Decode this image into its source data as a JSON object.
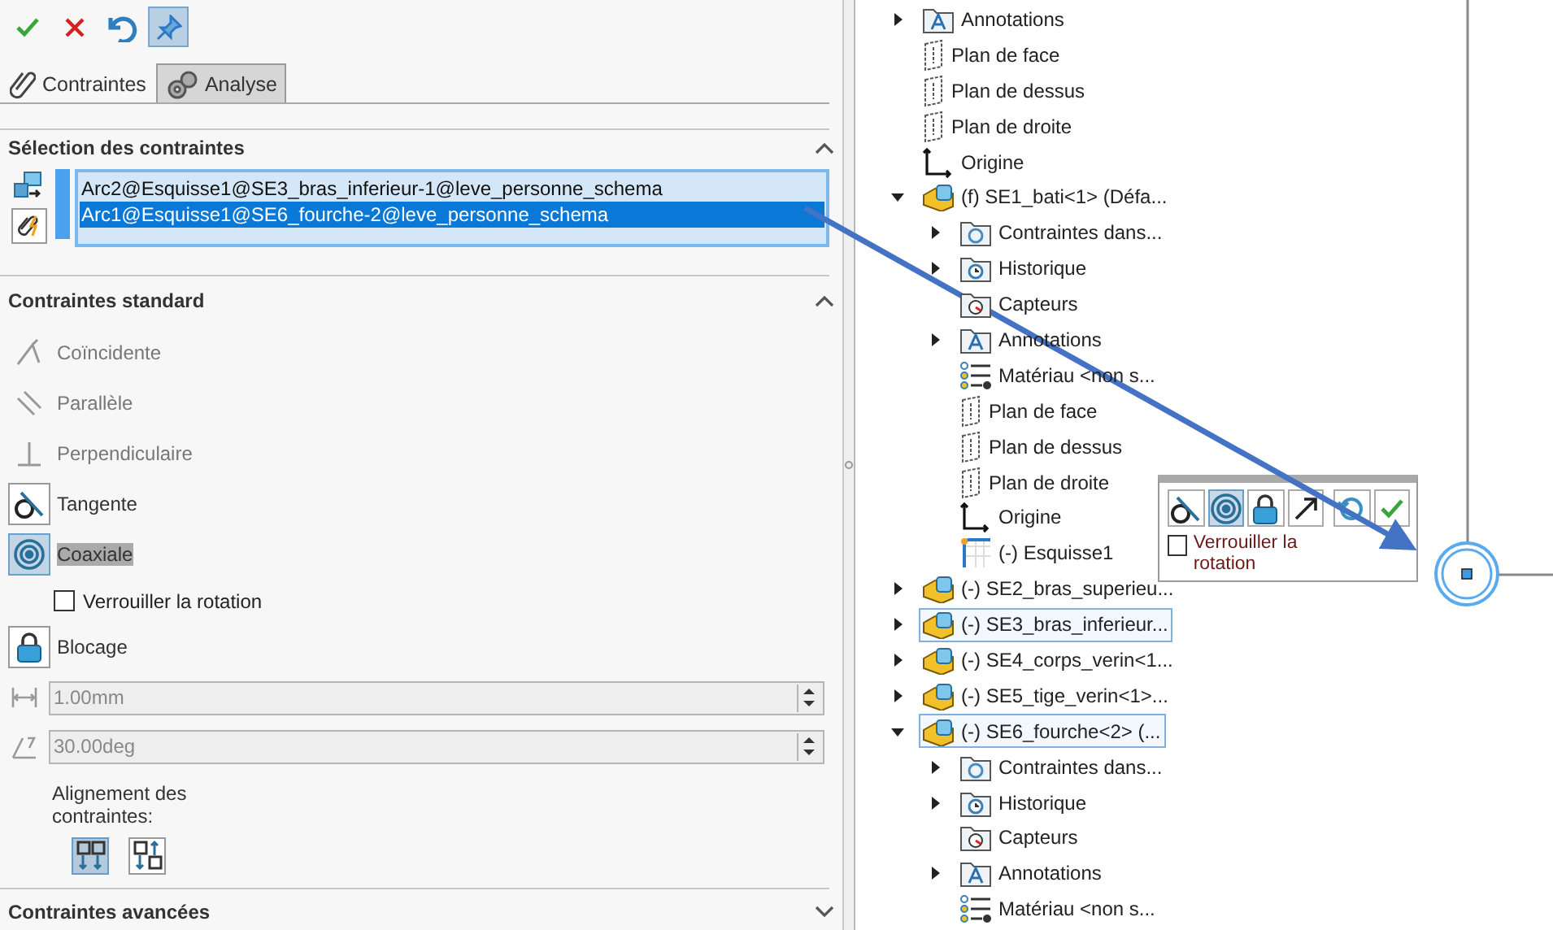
{
  "toolbar": [
    {
      "kind": "ok",
      "pressed": false
    },
    {
      "kind": "cancel",
      "pressed": false
    },
    {
      "kind": "undo",
      "pressed": false
    },
    {
      "kind": "pin",
      "pressed": true
    }
  ],
  "tabs": [
    {
      "label": "Contraintes",
      "kind": "paperclip",
      "selected": true
    },
    {
      "label": "Analyse",
      "kind": "gears",
      "selected": false
    }
  ],
  "selection_section": {
    "title": "Sélection des contraintes",
    "expanded": true,
    "entities": [
      {
        "text": "Arc2@Esquisse1@SE3_bras_inferieur-1@leve_personne_schema",
        "selected": false
      },
      {
        "text": "Arc1@Esquisse1@SE6_fourche-2@leve_personne_schema",
        "selected": true
      }
    ]
  },
  "standard_section": {
    "title": "Contraintes standard",
    "expanded": true,
    "rows": [
      {
        "kind": "coincident",
        "label": "Coïncidente",
        "disabled": true,
        "selected": false
      },
      {
        "kind": "parallel",
        "label": "Parallèle",
        "disabled": true,
        "selected": false
      },
      {
        "kind": "perpendicular",
        "label": "Perpendiculaire",
        "disabled": true,
        "selected": false
      },
      {
        "kind": "tangent",
        "label": "Tangente",
        "disabled": false,
        "selected": false
      },
      {
        "kind": "concentric",
        "label": "Coaxiale",
        "disabled": false,
        "selected": true
      },
      {
        "kind": "checkbox",
        "label": "Verrouiller la rotation",
        "checked": false
      },
      {
        "kind": "lock",
        "label": "Blocage",
        "disabled": false,
        "selected": false
      }
    ],
    "fields": [
      {
        "kind": "distance",
        "value": "1.00mm",
        "disabled": true
      },
      {
        "kind": "angle",
        "value": "30.00deg",
        "disabled": true
      }
    ],
    "alignment": {
      "label": "Alignement des contraintes:",
      "options": [
        {
          "kind": "aligned",
          "selected": true
        },
        {
          "kind": "anti-aligned",
          "selected": false
        }
      ]
    }
  },
  "advanced_section": {
    "title": "Contraintes avancées",
    "expanded": false
  },
  "tree": [
    {
      "label": "Annotations",
      "kind": "annotations",
      "expanded": false,
      "selected": false
    },
    {
      "label": "Plan de face",
      "kind": "plane",
      "selected": false
    },
    {
      "label": "Plan de dessus",
      "kind": "plane",
      "selected": false
    },
    {
      "label": "Plan de droite",
      "kind": "plane",
      "selected": false
    },
    {
      "label": "Origine",
      "kind": "origin",
      "selected": false
    },
    {
      "label": "(f) SE1_bati<1> (Défa...",
      "kind": "part",
      "expanded": true,
      "selected": false,
      "children": [
        {
          "label": "Contraintes dans...",
          "kind": "mates",
          "expanded": false,
          "selected": false
        },
        {
          "label": "Historique",
          "kind": "history",
          "expanded": false,
          "selected": false
        },
        {
          "label": "Capteurs",
          "kind": "sensors",
          "selected": false
        },
        {
          "label": "Annotations",
          "kind": "annotations",
          "expanded": false,
          "selected": false
        },
        {
          "label": "Matériau <non s...",
          "kind": "material",
          "selected": false
        },
        {
          "label": "Plan de face",
          "kind": "plane",
          "selected": false
        },
        {
          "label": "Plan de dessus",
          "kind": "plane",
          "selected": false
        },
        {
          "label": "Plan de droite",
          "kind": "plane",
          "selected": false
        },
        {
          "label": "Origine",
          "kind": "origin",
          "selected": false
        },
        {
          "label": "(-) Esquisse1",
          "kind": "sketch",
          "selected": false
        }
      ]
    },
    {
      "label": "(-) SE2_bras_superieu...",
      "kind": "part",
      "expanded": false,
      "selected": false
    },
    {
      "label": "(-) SE3_bras_inferieur...",
      "kind": "part",
      "expanded": false,
      "selected": true
    },
    {
      "label": "(-) SE4_corps_verin<1...",
      "kind": "part",
      "expanded": false,
      "selected": false
    },
    {
      "label": "(-) SE5_tige_verin<1>...",
      "kind": "part",
      "expanded": false,
      "selected": false
    },
    {
      "label": "(-) SE6_fourche<2> (...",
      "kind": "part",
      "expanded": true,
      "selected": true,
      "children": [
        {
          "label": "Contraintes dans...",
          "kind": "mates",
          "expanded": false,
          "selected": false
        },
        {
          "label": "Historique",
          "kind": "history",
          "expanded": false,
          "selected": false
        },
        {
          "label": "Capteurs",
          "kind": "sensors",
          "selected": false
        },
        {
          "label": "Annotations",
          "kind": "annotations",
          "expanded": false,
          "selected": false
        },
        {
          "label": "Matériau <non s...",
          "kind": "material",
          "selected": false
        }
      ]
    }
  ],
  "popup": {
    "buttons": [
      {
        "kind": "tangent",
        "selected": false
      },
      {
        "kind": "concentric",
        "selected": true
      },
      {
        "kind": "lock",
        "selected": false
      },
      {
        "kind": "flip",
        "selected": false
      },
      {
        "kind": "rotate",
        "selected": false
      },
      {
        "kind": "ok",
        "selected": false
      }
    ],
    "lock_rotation": {
      "label": "Verrouiller la rotation",
      "checked": false
    }
  }
}
